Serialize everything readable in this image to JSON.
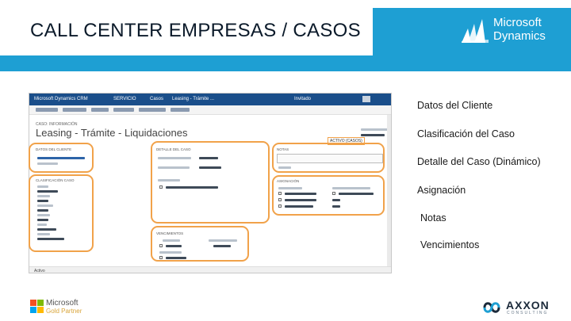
{
  "header": {
    "title": "CALL CENTER EMPRESAS / CASOS",
    "logo_line1": "Microsoft",
    "logo_line2": "Dynamics"
  },
  "crm": {
    "nav": {
      "app": "Microsoft Dynamics CRM",
      "area": "SERVICIO",
      "entity": "Casos",
      "record": "Leasing - Trámite ...",
      "user": "Invitado"
    },
    "breadcrumb": "CASO: INFORMACIÓN",
    "form_title": "Leasing - Trámite - Liquidaciones",
    "header_field": "ACTIVO (CASOS)",
    "footer_status": "Activo",
    "sections": {
      "cliente": "DATOS DEL CLIENTE",
      "clasificacion": "CLASIFICACIÓN CASO",
      "detalle": "DETALLE DEL CASO",
      "asignacion": "ASIGNACIÓN",
      "vencimientos": "VENCIMIENTOS",
      "notas": "NOTAS"
    }
  },
  "legend": [
    "Datos del Cliente",
    "Clasificación del Caso",
    "Detalle del Caso (Dinámico)",
    "Asignación",
    "Notas",
    "Vencimientos"
  ],
  "footer": {
    "partner_line1": "Microsoft",
    "partner_line2": "Gold Partner",
    "axxon_name": "AXXON",
    "axxon_sub": "CONSULTING"
  },
  "colors": {
    "header_band": "#1e9fd3",
    "highlight_ring": "#f1a24a",
    "crm_nav": "#1a4e8a"
  }
}
